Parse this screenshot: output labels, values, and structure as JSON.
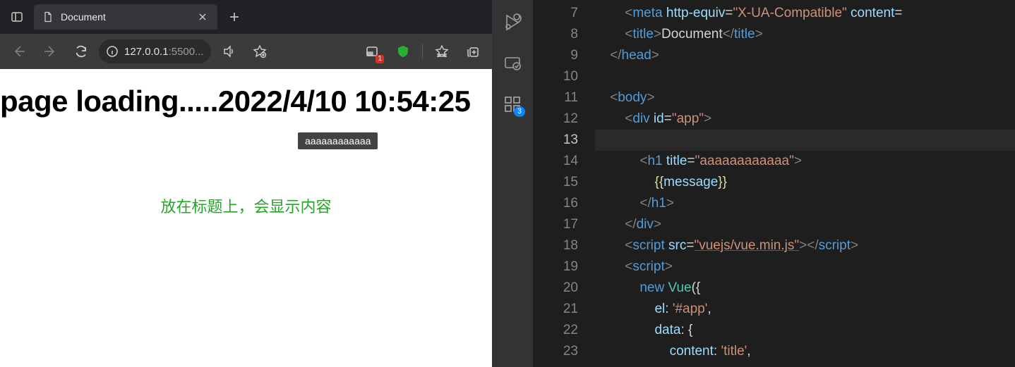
{
  "browser": {
    "tab": {
      "title": "Document"
    },
    "url": {
      "host": "127.0.0.1",
      "rest": ":5500..."
    },
    "devtools_badge": "1",
    "page": {
      "heading": "page loading.....2022/4/10 10:54:25",
      "tooltip": "aaaaaaaaaaaa",
      "caption": "放在标题上，会显示内容"
    }
  },
  "activity": {
    "ext_badge": "3"
  },
  "editor": {
    "lines": [
      {
        "n": "7",
        "indent": "        ",
        "k": "meta",
        "tok": [
          [
            "brkt",
            "<"
          ],
          [
            "tag",
            "meta"
          ],
          [
            "must",
            " "
          ],
          [
            "attr",
            "http-equiv"
          ],
          [
            "must",
            "="
          ],
          [
            "str",
            "\"X-UA-Compatible\""
          ],
          [
            "must",
            " "
          ],
          [
            "attr",
            "content"
          ],
          [
            "must",
            "="
          ]
        ]
      },
      {
        "n": "8",
        "indent": "        ",
        "k": "title",
        "tok": [
          [
            "brkt",
            "<"
          ],
          [
            "tag",
            "title"
          ],
          [
            "brkt",
            ">"
          ],
          [
            "must",
            "Document"
          ],
          [
            "brkt",
            "</"
          ],
          [
            "tag",
            "title"
          ],
          [
            "brkt",
            ">"
          ]
        ]
      },
      {
        "n": "9",
        "indent": "    ",
        "k": "headclose",
        "tok": [
          [
            "brkt",
            "</"
          ],
          [
            "tag",
            "head"
          ],
          [
            "brkt",
            ">"
          ]
        ]
      },
      {
        "n": "10",
        "indent": "",
        "k": "blank",
        "tok": []
      },
      {
        "n": "11",
        "indent": "    ",
        "k": "body",
        "tok": [
          [
            "brkt",
            "<"
          ],
          [
            "tag",
            "body"
          ],
          [
            "brkt",
            ">"
          ]
        ]
      },
      {
        "n": "12",
        "indent": "        ",
        "k": "div",
        "tok": [
          [
            "brkt",
            "<"
          ],
          [
            "tag",
            "div"
          ],
          [
            "must",
            " "
          ],
          [
            "attr",
            "id"
          ],
          [
            "must",
            "="
          ],
          [
            "str",
            "\"app\""
          ],
          [
            "brkt",
            ">"
          ]
        ]
      },
      {
        "n": "13",
        "indent": "",
        "k": "cursor",
        "tok": []
      },
      {
        "n": "14",
        "indent": "            ",
        "k": "h1o",
        "tok": [
          [
            "brkt",
            "<"
          ],
          [
            "tag",
            "h1"
          ],
          [
            "must",
            " "
          ],
          [
            "attr",
            "title"
          ],
          [
            "must",
            "="
          ],
          [
            "str",
            "\"aaaaaaaaaaaa\""
          ],
          [
            "brkt",
            ">"
          ]
        ]
      },
      {
        "n": "15",
        "indent": "                ",
        "k": "must",
        "tok": [
          [
            "brace",
            "{{"
          ],
          [
            "prop",
            "message"
          ],
          [
            "brace",
            "}}"
          ]
        ]
      },
      {
        "n": "16",
        "indent": "            ",
        "k": "h1c",
        "tok": [
          [
            "brkt",
            "</"
          ],
          [
            "tag",
            "h1"
          ],
          [
            "brkt",
            ">"
          ]
        ]
      },
      {
        "n": "17",
        "indent": "        ",
        "k": "divc",
        "tok": [
          [
            "brkt",
            "</"
          ],
          [
            "tag",
            "div"
          ],
          [
            "brkt",
            ">"
          ]
        ]
      },
      {
        "n": "18",
        "indent": "        ",
        "k": "script1",
        "tok": [
          [
            "brkt",
            "<"
          ],
          [
            "tag",
            "script"
          ],
          [
            "must",
            " "
          ],
          [
            "attr",
            "src"
          ],
          [
            "must",
            "="
          ],
          [
            "link",
            "\"vuejs/vue.min.js\""
          ],
          [
            "brkt",
            "></"
          ],
          [
            "tag",
            "script"
          ],
          [
            "brkt",
            ">"
          ]
        ]
      },
      {
        "n": "19",
        "indent": "        ",
        "k": "script2",
        "tok": [
          [
            "brkt",
            "<"
          ],
          [
            "tag",
            "script"
          ],
          [
            "brkt",
            ">"
          ]
        ]
      },
      {
        "n": "20",
        "indent": "            ",
        "k": "new",
        "tok": [
          [
            "key",
            "new"
          ],
          [
            "must",
            " "
          ],
          [
            "fn",
            "Vue"
          ],
          [
            "must",
            "({"
          ]
        ]
      },
      {
        "n": "21",
        "indent": "                ",
        "k": "el",
        "tok": [
          [
            "prop",
            "el"
          ],
          [
            "must",
            ": "
          ],
          [
            "str",
            "'#app'"
          ],
          [
            "must",
            ","
          ]
        ]
      },
      {
        "n": "22",
        "indent": "                ",
        "k": "data",
        "tok": [
          [
            "prop",
            "data"
          ],
          [
            "must",
            ": {"
          ]
        ]
      },
      {
        "n": "23",
        "indent": "                    ",
        "k": "content",
        "tok": [
          [
            "prop",
            "content"
          ],
          [
            "must",
            ": "
          ],
          [
            "str",
            "'title'"
          ],
          [
            "must",
            ","
          ]
        ]
      }
    ]
  }
}
